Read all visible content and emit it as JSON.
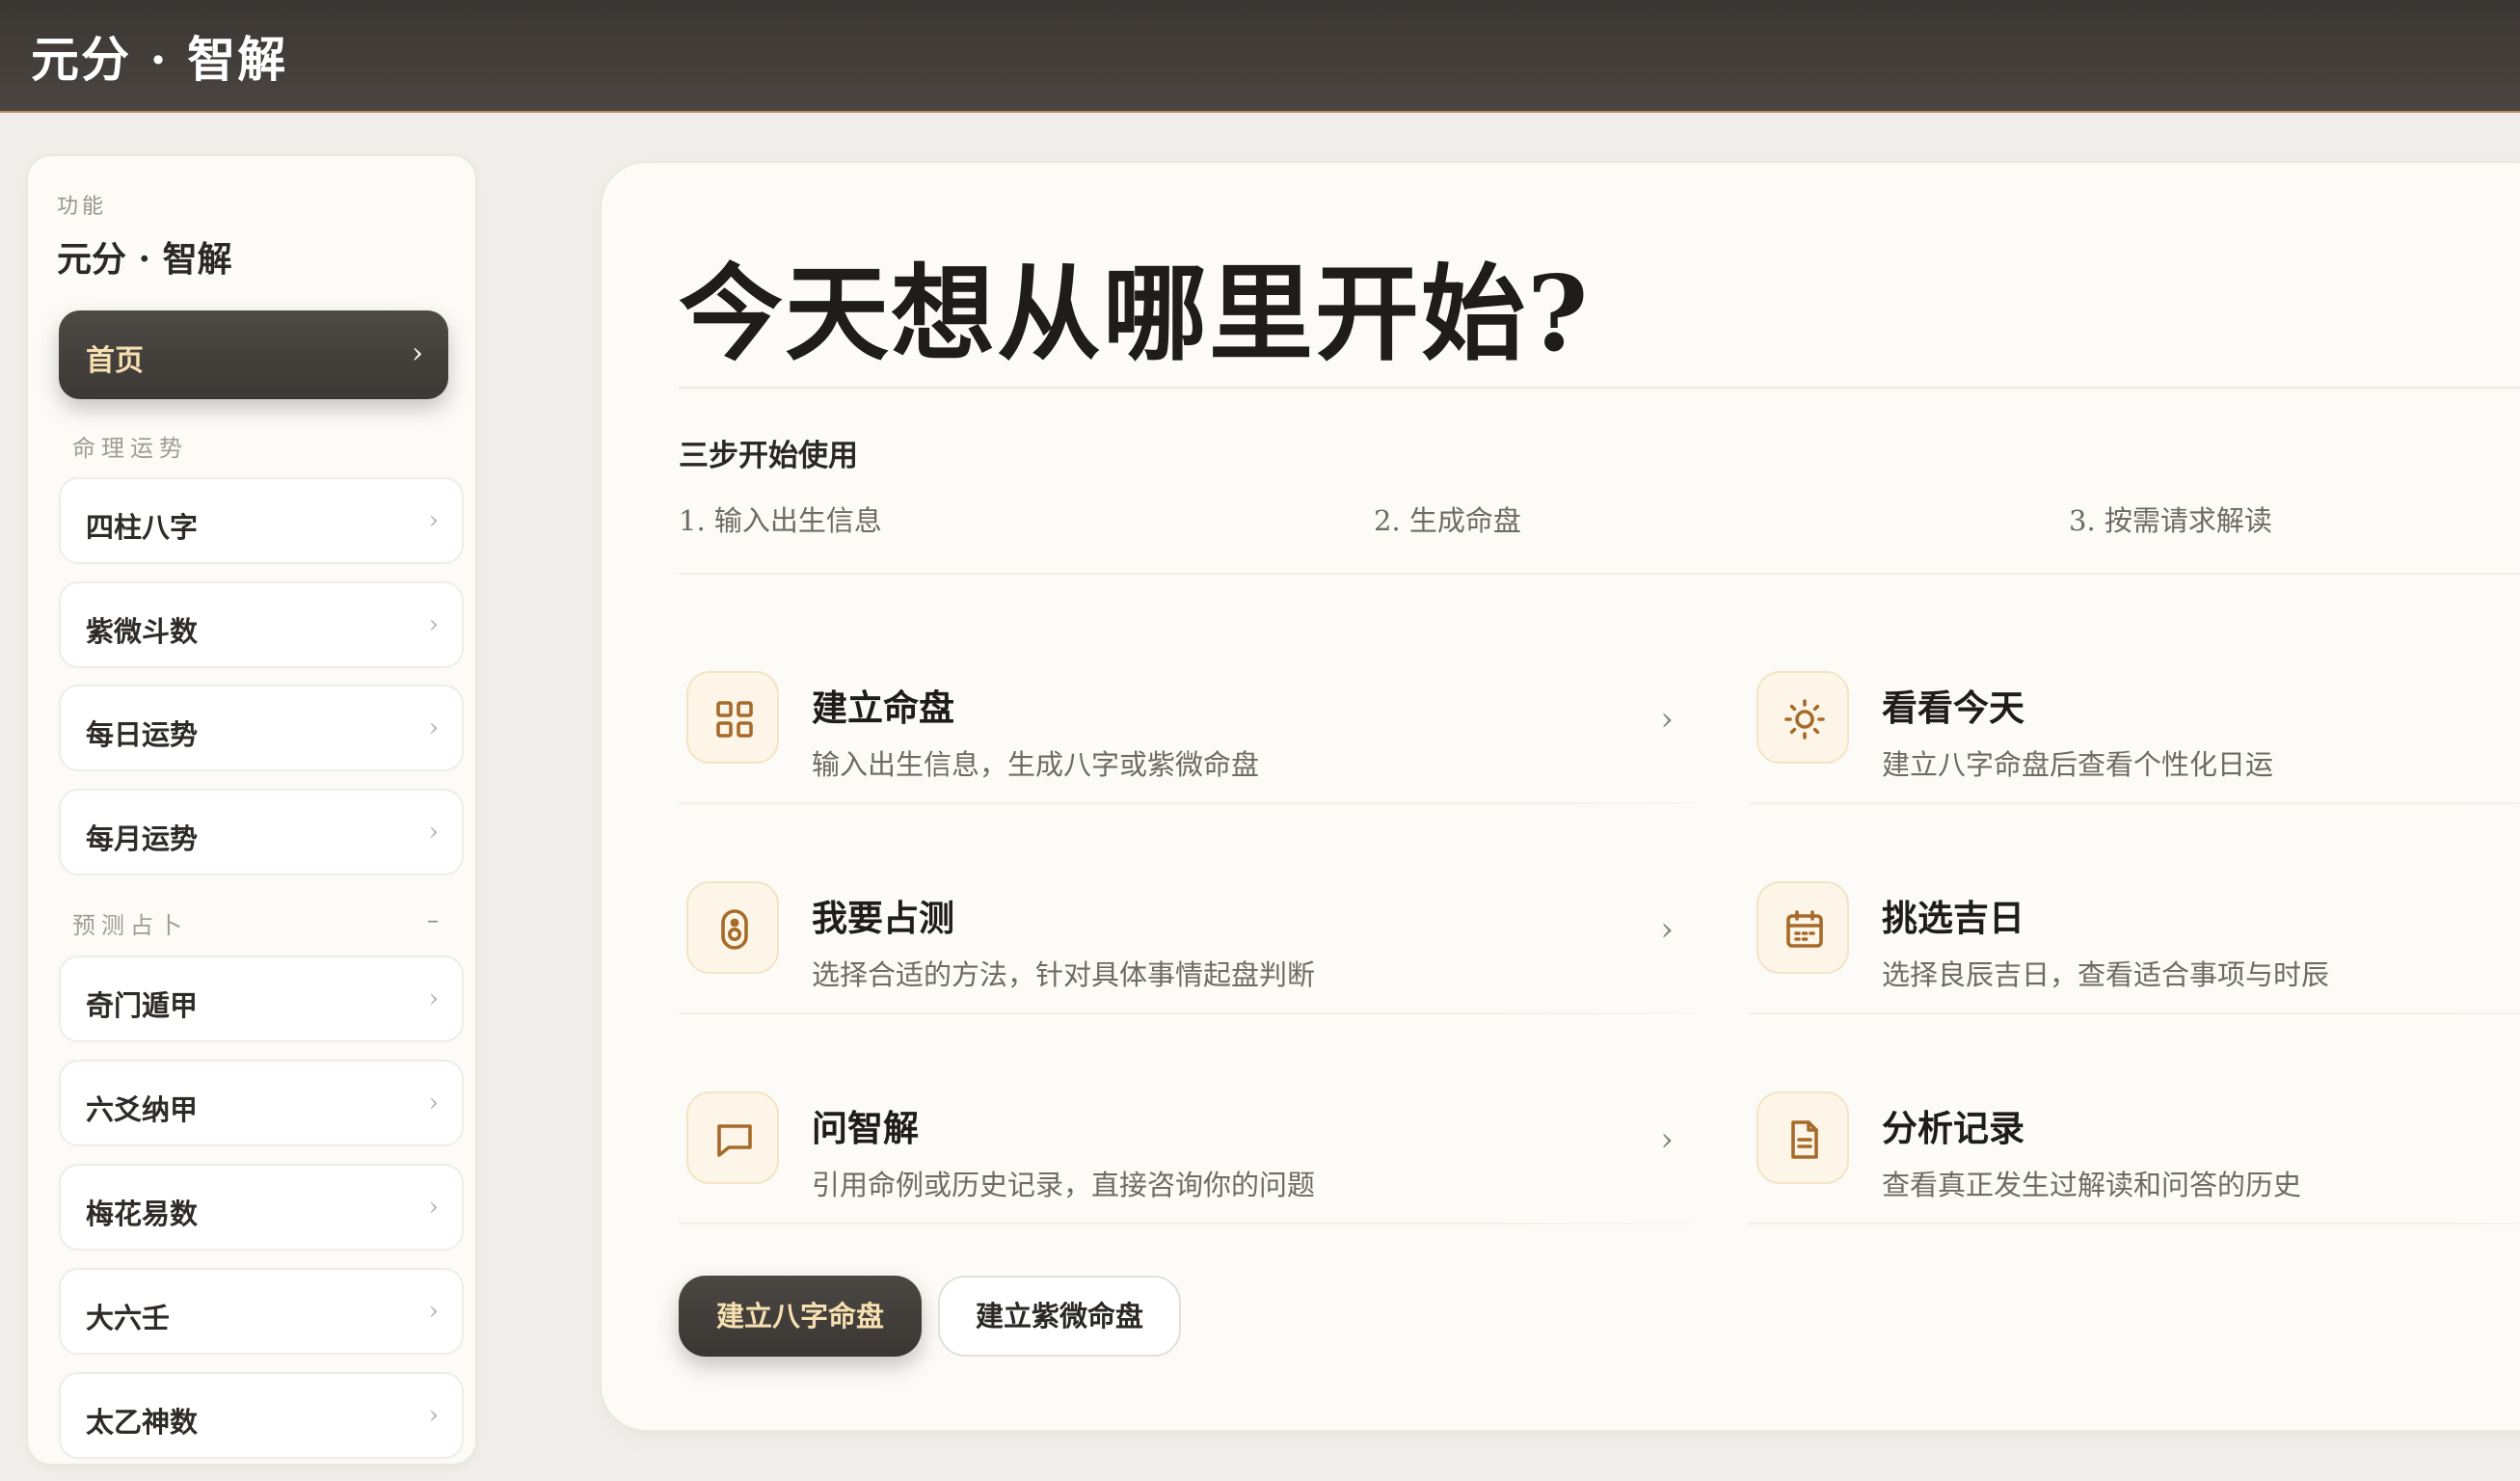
{
  "app": {
    "title": "元分 · 智解"
  },
  "sidebar": {
    "eyebrow": "功能",
    "title": "元分 · 智解",
    "home": {
      "label": "首页",
      "chevron": "›"
    },
    "sections": [
      {
        "label": "命理运势",
        "items": [
          {
            "label": "四柱八字",
            "chevron": "›"
          },
          {
            "label": "紫微斗数",
            "chevron": "›"
          },
          {
            "label": "每日运势",
            "chevron": "›"
          },
          {
            "label": "每月运势",
            "chevron": "›"
          }
        ]
      },
      {
        "label": "预测占卜",
        "collapse": "–",
        "items": [
          {
            "label": "奇门遁甲",
            "chevron": "›"
          },
          {
            "label": "六爻纳甲",
            "chevron": "›"
          },
          {
            "label": "梅花易数",
            "chevron": "›"
          },
          {
            "label": "大六壬",
            "chevron": "›"
          },
          {
            "label": "太乙神数",
            "chevron": "›"
          }
        ]
      }
    ]
  },
  "main": {
    "heading": "今天想从哪里开始?",
    "steps": {
      "title": "三步开始使用",
      "items": [
        "1. 输入出生信息",
        "2. 生成命盘",
        "3. 按需请求解读"
      ]
    },
    "cards": [
      {
        "title": "建立命盘",
        "desc": "输入出生信息，生成八字或紫微命盘",
        "icon": "grid-icon",
        "chevron": "›"
      },
      {
        "title": "看看今天",
        "desc": "建立八字命盘后查看个性化日运",
        "icon": "sun-icon",
        "chevron": "›"
      },
      {
        "title": "我要占测",
        "desc": "选择合适的方法，针对具体事情起盘判断",
        "icon": "divination-icon",
        "chevron": "›"
      },
      {
        "title": "挑选吉日",
        "desc": "选择良辰吉日，查看适合事项与时辰",
        "icon": "calendar-icon",
        "chevron": "›"
      },
      {
        "title": "问智解",
        "desc": "引用命例或历史记录，直接咨询你的问题",
        "icon": "chat-icon",
        "chevron": "›"
      },
      {
        "title": "分析记录",
        "desc": "查看真正发生过解读和问答的历史",
        "icon": "document-icon",
        "chevron": "›"
      }
    ],
    "buttons": {
      "primary": "建立八字命盘",
      "secondary": "建立紫微命盘"
    }
  },
  "colors": {
    "accent_gold": "#f6dfb0",
    "icon_brown": "#a66a2a",
    "dark_bar": "#3c3835",
    "panel_bg": "#fcfbf8"
  }
}
